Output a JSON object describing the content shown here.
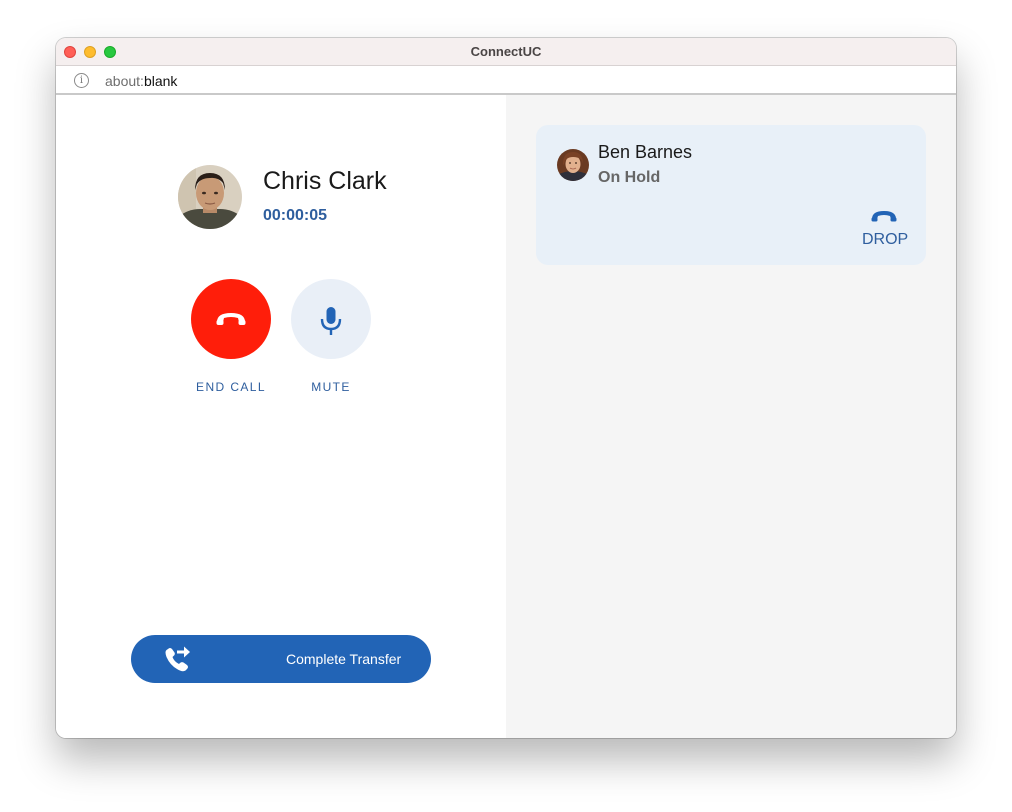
{
  "window": {
    "title": "ConnectUC"
  },
  "address_bar": {
    "scheme": "about:",
    "path": "blank"
  },
  "active_call": {
    "caller_name": "Chris Clark",
    "duration": "00:00:05",
    "end_call_label": "END CALL",
    "mute_label": "MUTE",
    "transfer_label": "Complete Transfer"
  },
  "held_call": {
    "name": "Ben Barnes",
    "status": "On Hold",
    "drop_label": "DROP"
  },
  "colors": {
    "end_call": "#ff1e0a",
    "accent": "#2264b6",
    "accent_text": "#2e5e9e",
    "mute_bg": "#e9eff7",
    "hold_card_bg": "#e8f0f8"
  },
  "icons": {
    "end_call": "phone-hangup-icon",
    "mute": "microphone-icon",
    "transfer": "phone-transfer-icon",
    "drop": "phone-hangup-icon",
    "info": "info-icon"
  }
}
